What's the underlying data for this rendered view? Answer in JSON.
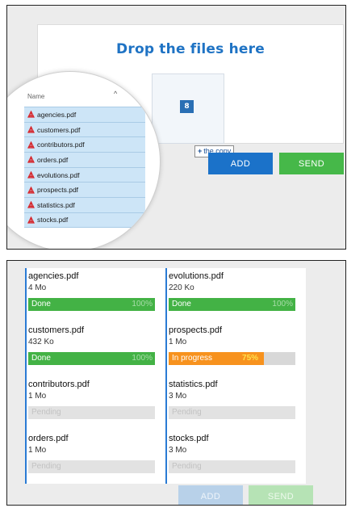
{
  "dropzone": {
    "title": "Drop the files here",
    "drag_count": "8",
    "drag_tooltip": "the copy",
    "add_label": "ADD",
    "send_label": "SEND"
  },
  "file_list": {
    "column_name": "Name",
    "sort_indicator": "^",
    "icon": "pdf-icon",
    "files": [
      "agencies.pdf",
      "customers.pdf",
      "contributors.pdf",
      "orders.pdf",
      "evolutions.pdf",
      "prospects.pdf",
      "statistics.pdf",
      "stocks.pdf"
    ]
  },
  "uploads": {
    "left": [
      {
        "name": "agencies.pdf",
        "size": "4 Mo",
        "status": "Done",
        "percent_label": "100%",
        "progress": 1.0,
        "state": "done"
      },
      {
        "name": "customers.pdf",
        "size": "432 Ko",
        "status": "Done",
        "percent_label": "100%",
        "progress": 1.0,
        "state": "done"
      },
      {
        "name": "contributors.pdf",
        "size": "1 Mo",
        "status": "Pending",
        "percent_label": "",
        "progress": 0,
        "state": "pending"
      },
      {
        "name": "orders.pdf",
        "size": "1 Mo",
        "status": "Pending",
        "percent_label": "",
        "progress": 0,
        "state": "pending"
      }
    ],
    "right": [
      {
        "name": "evolutions.pdf",
        "size": "220 Ko",
        "status": "Done",
        "percent_label": "100%",
        "progress": 1.0,
        "state": "done"
      },
      {
        "name": "prospects.pdf",
        "size": "1 Mo",
        "status": "In progress",
        "percent_label": "75%",
        "progress": 0.75,
        "state": "progress"
      },
      {
        "name": "statistics.pdf",
        "size": "3 Mo",
        "status": "Pending",
        "percent_label": "",
        "progress": 0,
        "state": "pending"
      },
      {
        "name": "stocks.pdf",
        "size": "3 Mo",
        "status": "Pending",
        "percent_label": "",
        "progress": 0,
        "state": "pending"
      }
    ],
    "add_label": "ADD",
    "send_label": "SEND"
  },
  "colors": {
    "accent_blue": "#1b72c9",
    "send_green": "#46b849",
    "done_green": "#43b245",
    "progress_orange": "#f7921e",
    "selection_blue": "#cde5f7"
  }
}
